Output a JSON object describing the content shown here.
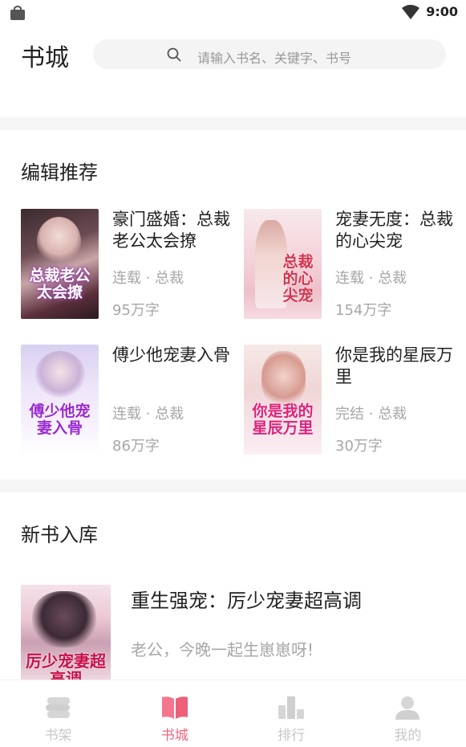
{
  "status_bar": {
    "time": "9:00"
  },
  "header": {
    "title": "书城",
    "search_placeholder": "请输入书名、关键字、书号"
  },
  "editor_picks": {
    "title": "编辑推荐",
    "books": [
      {
        "title": "豪门盛婚：总裁老公太会撩",
        "status": "连载",
        "genre": "总裁",
        "words": "95万字",
        "cover_text": "总裁老公太会撩"
      },
      {
        "title": "宠妻无度：总裁的心尖宠",
        "status": "连载",
        "genre": "总裁",
        "words": "154万字",
        "cover_text": "总裁的心尖宠"
      },
      {
        "title": "傅少他宠妻入骨",
        "status": "连载",
        "genre": "总裁",
        "words": "86万字",
        "cover_text": "傅少他宠妻入骨"
      },
      {
        "title": "你是我的星辰万里",
        "status": "完结",
        "genre": "总裁",
        "words": "30万字",
        "cover_text": "你是我的星辰万里"
      }
    ]
  },
  "new_books": {
    "title": "新书入库",
    "items": [
      {
        "title": "重生强宠：厉少宠妻超高调",
        "desc": "老公，今晚一起生崽崽呀!",
        "cover_text": "厉少宠妻超高调"
      }
    ]
  },
  "bottom_nav": {
    "items": [
      {
        "label": "书架",
        "icon": "bookshelf-icon",
        "active": false
      },
      {
        "label": "书城",
        "icon": "book-open-icon",
        "active": true
      },
      {
        "label": "排行",
        "icon": "ranking-icon",
        "active": false
      },
      {
        "label": "我的",
        "icon": "profile-icon",
        "active": false
      }
    ]
  },
  "colors": {
    "accent": "#f0667f",
    "inactive": "#c7c7c7",
    "meta": "#a7a7a7",
    "divider": "#f5f5f5"
  }
}
